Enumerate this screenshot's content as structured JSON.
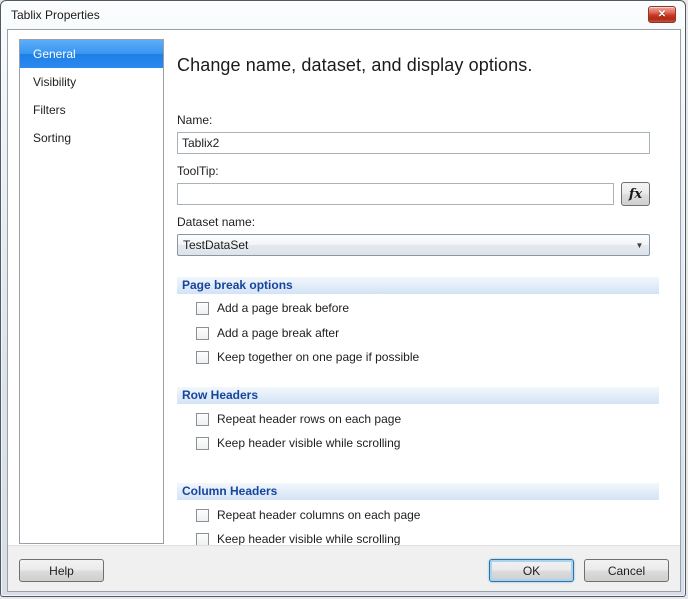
{
  "window": {
    "title": "Tablix Properties"
  },
  "icons": {
    "close": "✕",
    "dropdown_arrow": "▼",
    "fx": "fx"
  },
  "colors": {
    "selection_blue": "#2f8be8",
    "section_header_text": "#17449e",
    "section_header_bg": "#d3e3f5",
    "default_button_ring": "#a9d4f0",
    "close_button_red": "#c93822"
  },
  "sidebar": {
    "items": [
      {
        "label": "General",
        "selected": true
      },
      {
        "label": "Visibility",
        "selected": false
      },
      {
        "label": "Filters",
        "selected": false
      },
      {
        "label": "Sorting",
        "selected": false
      }
    ]
  },
  "main": {
    "heading": "Change name, dataset, and display options.",
    "name_field": {
      "label": "Name:",
      "value": "Tablix2"
    },
    "tooltip_field": {
      "label": "ToolTip:",
      "value": ""
    },
    "dataset_field": {
      "label": "Dataset name:",
      "value": "TestDataSet"
    },
    "sections": [
      {
        "title": "Page break options",
        "checkboxes": [
          {
            "label": "Add a page break before",
            "checked": false
          },
          {
            "label": "Add a page break after",
            "checked": false
          },
          {
            "label": "Keep together on one page if possible",
            "checked": false
          }
        ]
      },
      {
        "title": "Row Headers",
        "checkboxes": [
          {
            "label": "Repeat header rows on each page",
            "checked": false
          },
          {
            "label": "Keep header visible while scrolling",
            "checked": false
          }
        ]
      },
      {
        "title": "Column Headers",
        "checkboxes": [
          {
            "label": "Repeat header columns on each page",
            "checked": false
          },
          {
            "label": "Keep header visible while scrolling",
            "checked": false
          }
        ]
      }
    ]
  },
  "footer": {
    "help": "Help",
    "ok": "OK",
    "cancel": "Cancel"
  }
}
